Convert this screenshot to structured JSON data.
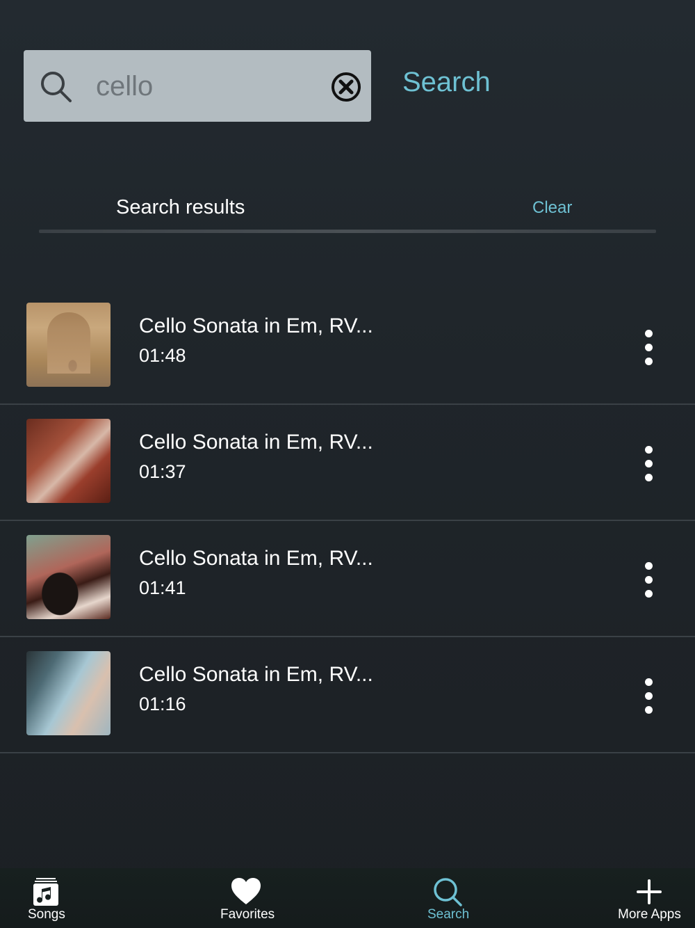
{
  "search": {
    "value": "cello",
    "placeholder": "",
    "action_label": "Search"
  },
  "results": {
    "title": "Search results",
    "clear_label": "Clear",
    "items": [
      {
        "title": "Cello Sonata in Em, RV...",
        "duration": "01:48",
        "thumb": "cellist-archway-photo"
      },
      {
        "title": "Cello Sonata in Em, RV...",
        "duration": "01:37",
        "thumb": "hand-bowing-cello-photo"
      },
      {
        "title": "Cello Sonata in Em, RV...",
        "duration": "01:41",
        "thumb": "cello-bridge-closeup-photo"
      },
      {
        "title": "Cello Sonata in Em, RV...",
        "duration": "01:16",
        "thumb": "cello-strings-hand-photo"
      }
    ]
  },
  "tabs": [
    {
      "label": "Songs",
      "icon": "music-note-icon",
      "active": false
    },
    {
      "label": "Favorites",
      "icon": "heart-icon",
      "active": false
    },
    {
      "label": "Search",
      "icon": "search-icon",
      "active": true
    },
    {
      "label": "More Apps",
      "icon": "plus-icon",
      "active": false
    }
  ],
  "colors": {
    "accent": "#6ec1d3",
    "background": "#1f252a",
    "search_box": "#b3bcc1",
    "divider": "#3a4146"
  }
}
